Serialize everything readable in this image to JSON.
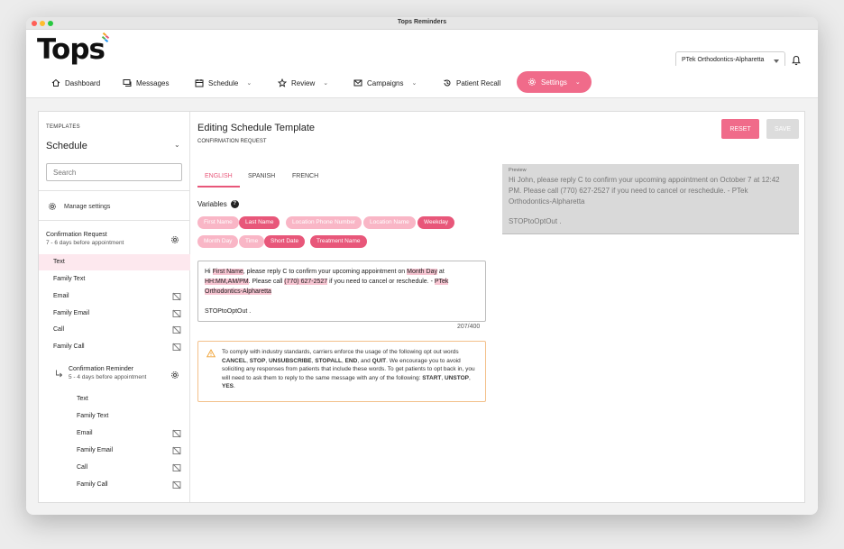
{
  "window": {
    "title": "Tops Reminders"
  },
  "header": {
    "logo": "Tops",
    "org_select": "PTek Orthodontics-Alpharetta"
  },
  "nav": [
    {
      "label": "Dashboard",
      "icon": "home-icon"
    },
    {
      "label": "Messages",
      "icon": "messages-icon"
    },
    {
      "label": "Schedule",
      "icon": "calendar-icon",
      "dropdown": true
    },
    {
      "label": "Review",
      "icon": "star-icon",
      "dropdown": true
    },
    {
      "label": "Campaigns",
      "icon": "mail-icon",
      "dropdown": true
    },
    {
      "label": "Patient Recall",
      "icon": "history-icon"
    },
    {
      "label": "Settings",
      "icon": "gear-icon",
      "dropdown": true,
      "active": true
    }
  ],
  "sidebar": {
    "section_label": "TEMPLATES",
    "selected_template": "Schedule",
    "search_placeholder": "Search",
    "manage_settings": "Manage settings",
    "groups": [
      {
        "title": "Confirmation Request",
        "subtitle": "7 - 6 days before appointment",
        "items": [
          "Text",
          "Family Text",
          "Email",
          "Family Email",
          "Call",
          "Family Call"
        ]
      },
      {
        "title": "Confirmation Reminder",
        "subtitle": "5 - 4 days before appointment",
        "items": [
          "Text",
          "Family Text",
          "Email",
          "Family Email",
          "Call",
          "Family Call"
        ]
      }
    ]
  },
  "editor": {
    "title": "Editing Schedule Template",
    "subtitle": "CONFIRMATION REQUEST",
    "reset_label": "RESET",
    "save_label": "SAVE",
    "tabs": [
      "ENGLISH",
      "SPANISH",
      "FRENCH"
    ],
    "variables_label": "Variables",
    "variables": [
      {
        "label": "First Name",
        "used": false
      },
      {
        "label": "Last Name",
        "used": true
      },
      {
        "label": "Location Phone Number",
        "used": false
      },
      {
        "label": "Location Name",
        "used": false
      },
      {
        "label": "Weekday",
        "used": true
      },
      {
        "label": "Month Day",
        "used": false
      },
      {
        "label": "Time",
        "used": false
      },
      {
        "label": "Short Date",
        "used": true
      },
      {
        "label": "Treatment Name",
        "used": true
      }
    ],
    "message": {
      "t1": "Hi ",
      "v1": "First Name",
      "t2": ", please reply C to confirm your upcoming appointment on ",
      "v2": "Month Day",
      "t3": " at ",
      "v3": "HH:MM,AM/PM",
      "t4": ". Please call ",
      "v4": "(770) 627-2527",
      "t5": " if you need to cancel or reschedule. - ",
      "v5": "PTek Orthodontics-Alpharetta",
      "opt_out": "STOPtoOptOut ."
    },
    "char_count": "207/400",
    "warning": {
      "t1": "To comply with industry standards, carriers enforce the usage of the following opt out words ",
      "w1": "CANCEL",
      "t2": ", ",
      "w2": "STOP",
      "t3": ", ",
      "w3": "UNSUBSCRIBE",
      "t4": ", ",
      "w4": "STOPALL",
      "t5": ", ",
      "w5": "END",
      "t6": ", and ",
      "w6": "QUIT",
      "t7": ". We encourage you to avoid soliciting any responses from patients that include these words. To get patients to opt back in, you will need to ask them to reply to the same message with any of the following: ",
      "w7": "START",
      "t8": ", ",
      "w8": "UNSTOP",
      "t9": ", ",
      "w9": "YES",
      "t10": "."
    },
    "preview": {
      "label": "Preview",
      "text": "Hi John, please reply C to confirm your upcoming appointment on October 7 at 12:42 PM. Please call (770) 627-2527 if you need to cancel or reschedule. - PTek Orthodontics-Alpharetta",
      "opt_out": "STOPtoOptOut ."
    }
  },
  "colors": {
    "accent": "#f06b8a",
    "accent_dark": "#e8577a",
    "accent_light": "#f9b6c6",
    "highlight": "#f7c5d2"
  }
}
